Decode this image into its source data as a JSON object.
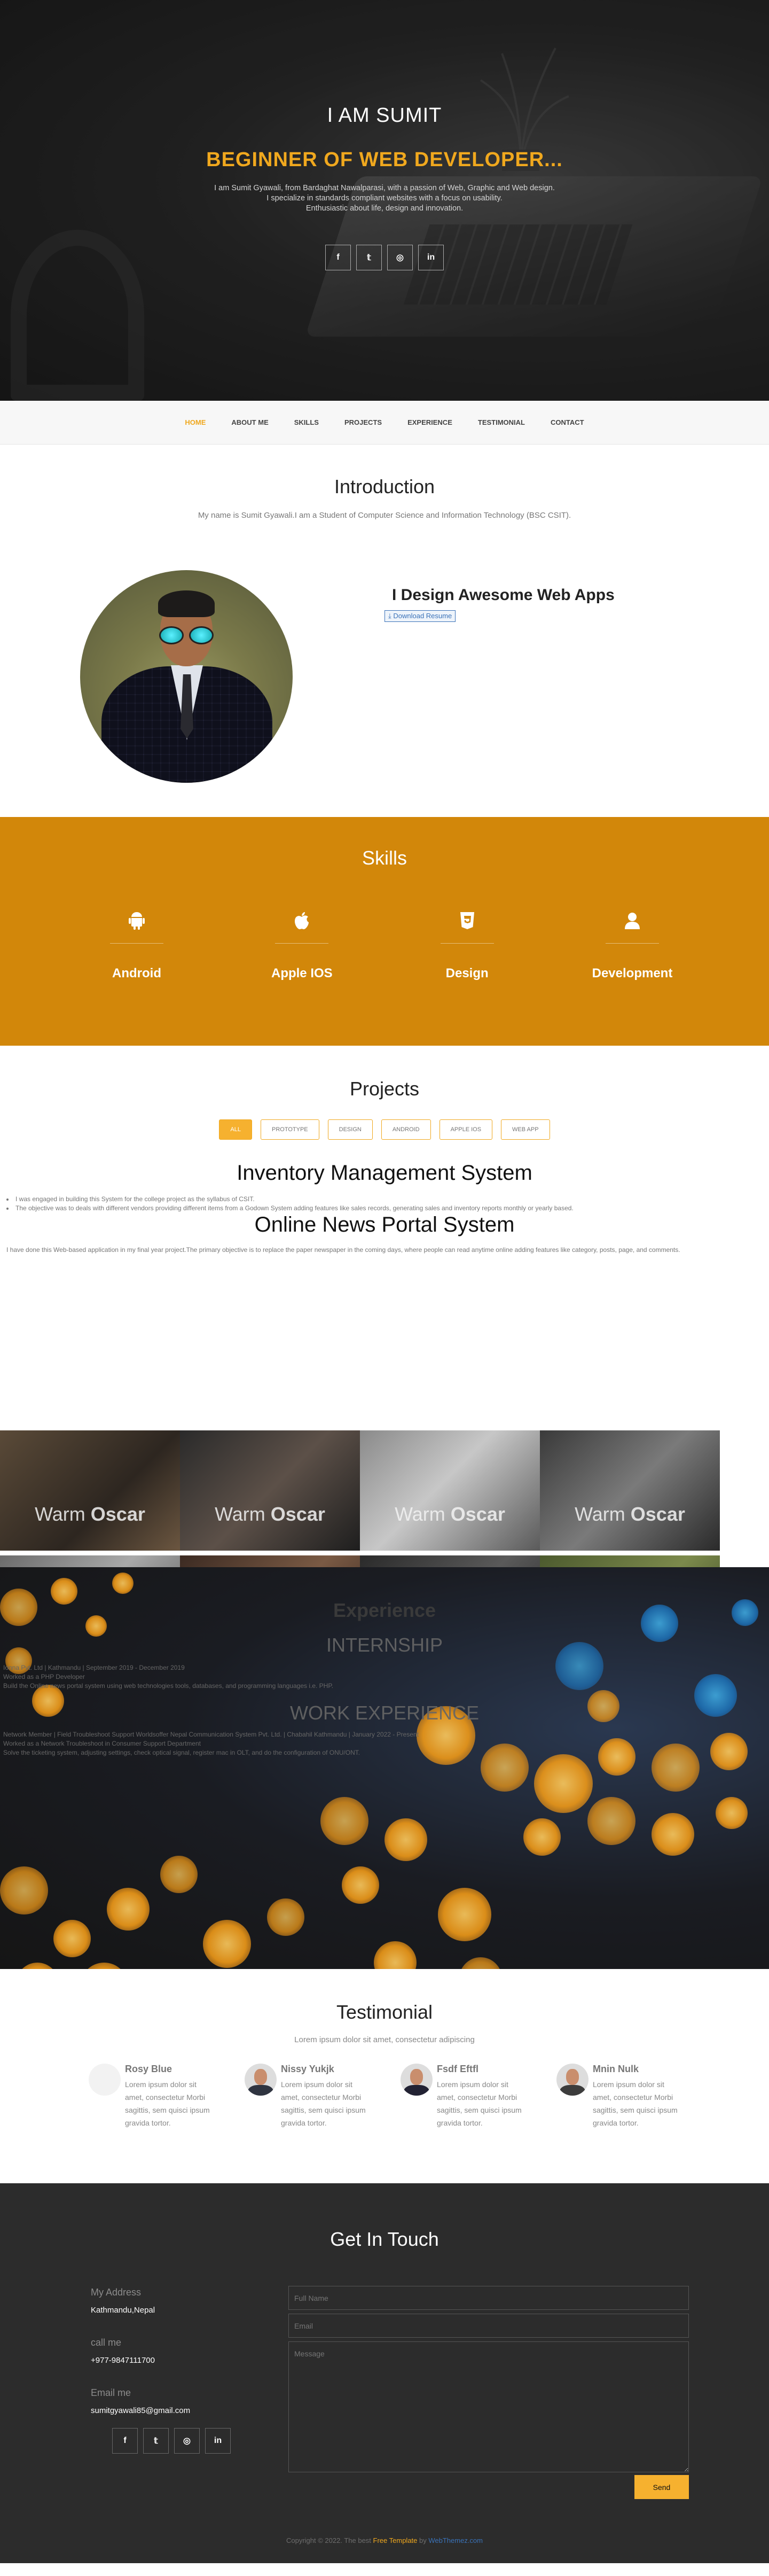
{
  "hero": {
    "name": "I AM SUMIT",
    "role": "BEGINNER OF WEB DEVELOPER...",
    "desc_line1": "I am Sumit Gyawali, from Bardaghat Nawalparasi, with a passion of Web, Graphic and Web design.",
    "desc_line2": "I specialize in standards compliant websites with a focus on usability.",
    "desc_line3": "Enthusiastic about life, design and innovation.",
    "social": [
      "f",
      "𝕥",
      "◎",
      "in"
    ]
  },
  "nav": {
    "items": [
      "HOME",
      "ABOUT ME",
      "SKILLS",
      "PROJECTS",
      "EXPERIENCE",
      "TESTIMONIAL",
      "CONTACT"
    ]
  },
  "intro": {
    "title": "Introduction",
    "subtitle": "My name is Sumit Gyawali.I am a Student of Computer Science and Information Technology (BSC CSIT).",
    "design_title": "I Design Awesome Web Apps",
    "download_label": "Download Resume"
  },
  "skills": {
    "title": "Skills",
    "items": [
      "Android",
      "Apple IOS",
      "Design",
      "Development"
    ]
  },
  "projects": {
    "title": "Projects",
    "filters": [
      "ALL",
      "PROTOTYPE",
      "DESIGN",
      "ANDROID",
      "APPLE IOS",
      "WEB APP"
    ],
    "p1_title": "Inventory Management System",
    "p1_bullets": [
      "I was engaged in building this System for the college project as the syllabus of CSIT.",
      "The objective was to deals with different vendors providing different items from a Godown System adding features like sales records, generating sales and inventory reports monthly or yearly based."
    ],
    "p2_title": "Online News Portal System",
    "p2_text": "I have done this Web-based application in my final year project.The primary objective is to replace the paper newspaper in the coming days, where people can read anytime online adding features like category, posts, page, and comments.",
    "tile_label_a": "Warm",
    "tile_label_b": "Oscar"
  },
  "experience": {
    "title": "Experience",
    "internship": "INTERNSHIP",
    "intern_items": [
      "Ionna Pvt. Ltd | Kathmandu | September 2019 - December 2019",
      "Worked as a PHP Developer",
      "Build the Online news portal system using web technologies tools, databases, and programming languages i.e. PHP."
    ],
    "work": "WORK EXPERIENCE",
    "work_items": [
      "Network Member | Field Troubleshoot Support Worldsoffer Nepal Communication System Pvt. Ltd. | Chabahil Kathmandu | January 2022 - Present",
      "Worked as a Network Troubleshoot in Consumer Support Department",
      "Solve the ticketing system, adjusting settings, check optical signal, register mac in OLT, and do the configuration of ONU/ONT."
    ]
  },
  "testimonial": {
    "title": "Testimonial",
    "subtitle": "Lorem ipsum dolor sit amet, consectetur adipiscing",
    "cards": [
      {
        "name": "Rosy Blue",
        "text": "Lorem ipsum dolor sit amet, consectetur Morbi sagittis, sem quisci ipsum gravida tortor."
      },
      {
        "name": "Nissy Yukjk",
        "text": "Lorem ipsum dolor sit amet, consectetur Morbi sagittis, sem quisci ipsum gravida tortor."
      },
      {
        "name": "Fsdf Eftfl",
        "text": "Lorem ipsum dolor sit amet, consectetur Morbi sagittis, sem quisci ipsum gravida tortor."
      },
      {
        "name": "Mnin Nulk",
        "text": "Lorem ipsum dolor sit amet, consectetur Morbi sagittis, sem quisci ipsum gravida tortor."
      }
    ]
  },
  "contact": {
    "title": "Get In Touch",
    "address_label": "My Address",
    "address": "Kathmandu,Nepal",
    "call_label": "call me",
    "phone": "+977-9847111700",
    "email_label": "Email me",
    "email": "sumitgyawali85@gmail.com",
    "fullname_placeholder": "Full Name",
    "email_placeholder": "Email",
    "message_placeholder": "Message",
    "send_label": "Send"
  },
  "footer": {
    "prefix": "Copyright © 2022. The best ",
    "link1": "Free Template",
    "middle": " by ",
    "link2": "WebThemez.com"
  },
  "colors": {
    "accent": "#f0a81e",
    "skills_bg": "#d2870a",
    "dark_bg": "#2c2c2c"
  }
}
